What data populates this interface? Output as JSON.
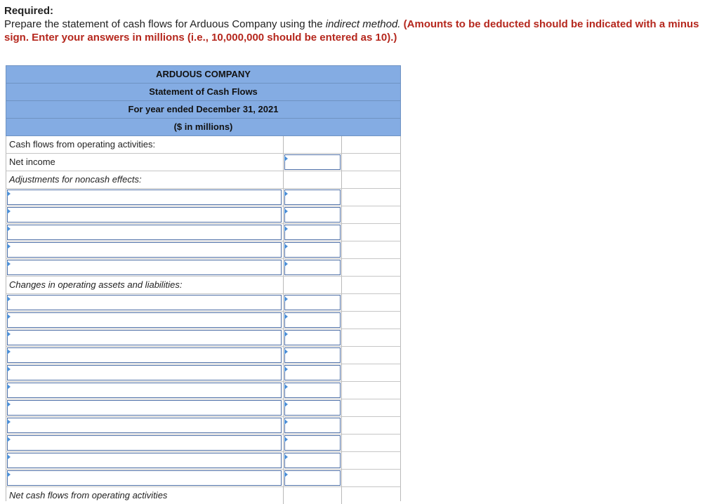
{
  "instructions": {
    "required": "Required:",
    "text_plain": "Prepare the statement of cash flows for Arduous Company using the ",
    "text_italic": "indirect method.",
    "text_red": "(Amounts to be deducted should be indicated with a minus sign. Enter your answers in millions (i.e., 10,000,000 should be entered as 10).)"
  },
  "statement": {
    "company": "ARDUOUS COMPANY",
    "title": "Statement of Cash Flows",
    "period": "For year ended December 31, 2021",
    "units": "($ in millions)"
  },
  "rows": {
    "operating_header": "Cash flows from operating activities:",
    "net_income": "Net income",
    "adjustments_header": "Adjustments for noncash effects:",
    "changes_header": "Changes in operating assets and liabilities:",
    "net_operating": "Net cash flows from operating activities"
  },
  "inputs": {
    "net_income_value": "",
    "adjustment_rows": 5,
    "change_rows": 11
  },
  "colors": {
    "header_fill": "#84ace3",
    "instruction_red": "#b5271d",
    "input_border": "#4e6fa6",
    "input_marker": "#4d8fd6"
  }
}
